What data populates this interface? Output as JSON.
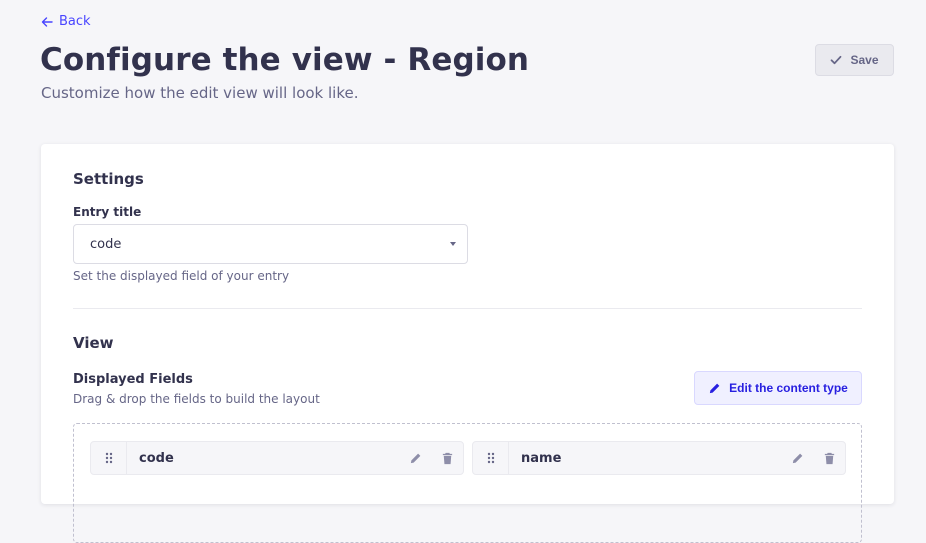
{
  "header": {
    "back_label": "Back",
    "title": "Configure the view - Region",
    "subtitle": "Customize how the edit view will look like.",
    "save_label": "Save"
  },
  "settings": {
    "section_title": "Settings",
    "entry_title_label": "Entry title",
    "entry_title_value": "code",
    "entry_title_hint": "Set the displayed field of your entry"
  },
  "view": {
    "section_title": "View",
    "displayed_fields_label": "Displayed Fields",
    "displayed_fields_hint": "Drag & drop the fields to build the layout",
    "edit_content_type_label": "Edit the content type",
    "fields": [
      {
        "name": "code"
      },
      {
        "name": "name"
      }
    ]
  },
  "colors": {
    "primary": "#4945ff",
    "background": "#f6f6f9",
    "text": "#32324d",
    "muted": "#666687"
  }
}
